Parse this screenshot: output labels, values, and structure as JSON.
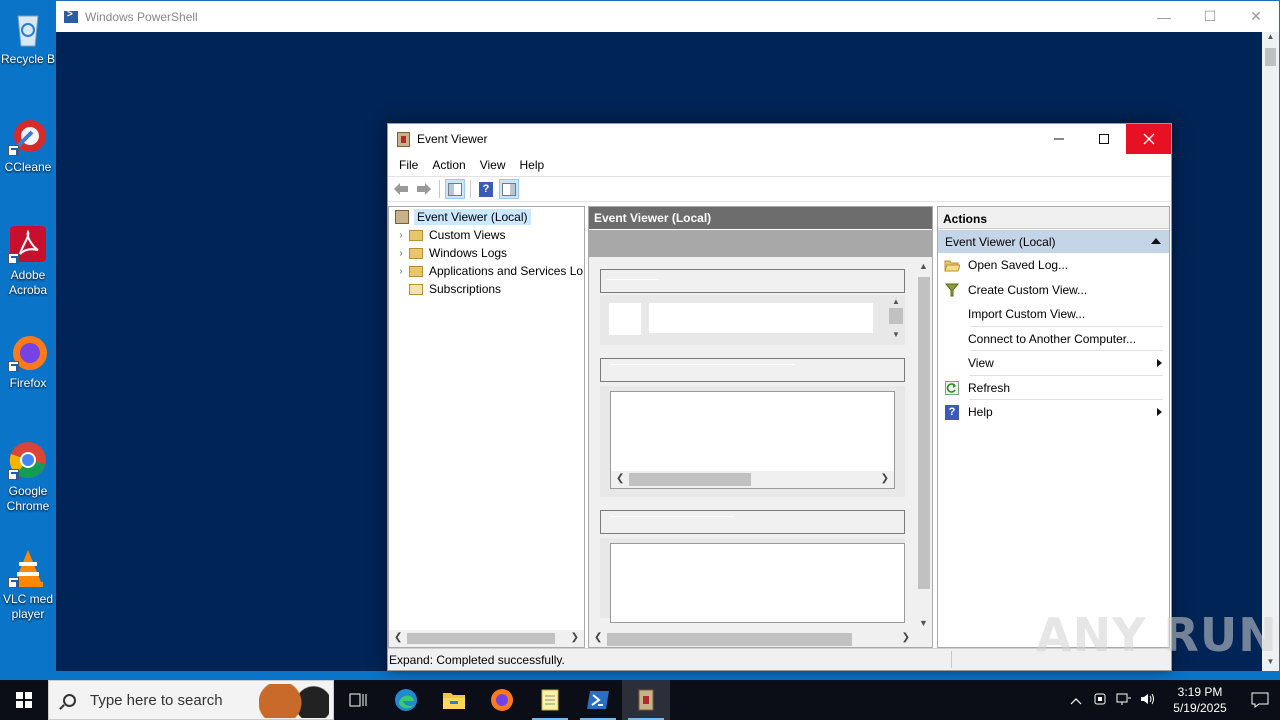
{
  "desktop": {
    "icons": [
      {
        "label": "Recycle B"
      },
      {
        "label": "CCleane"
      },
      {
        "label": "Adobe Acroba"
      },
      {
        "label": "Firefox"
      },
      {
        "label": "Google Chrome"
      },
      {
        "label": "VLC med player"
      }
    ]
  },
  "powershell": {
    "title": "Windows PowerShell",
    "controls": {
      "minimize": "—",
      "maximize": "☐",
      "close": "✕"
    }
  },
  "eventviewer": {
    "title": "Event Viewer",
    "menu": [
      "File",
      "Action",
      "View",
      "Help"
    ],
    "tree": {
      "root": "Event Viewer (Local)",
      "children": [
        "Custom Views",
        "Windows Logs",
        "Applications and Services Lo",
        "Subscriptions"
      ]
    },
    "center": {
      "header": "Event Viewer (Local)"
    },
    "actions": {
      "title": "Actions",
      "section": "Event Viewer (Local)",
      "items": [
        {
          "label": "Open Saved Log...",
          "icon": "folder-open-icon"
        },
        {
          "label": "Create Custom View...",
          "icon": "filter-icon"
        },
        {
          "label": "Import Custom View...",
          "icon": ""
        },
        {
          "label": "Connect to Another Computer...",
          "icon": ""
        },
        {
          "label": "View",
          "icon": "",
          "submenu": true
        },
        {
          "label": "Refresh",
          "icon": "refresh-icon"
        },
        {
          "label": "Help",
          "icon": "help-icon",
          "submenu": true
        }
      ]
    },
    "status": "Expand:  Completed successfully."
  },
  "taskbar": {
    "search_placeholder": "Type here to search",
    "clock_time": "3:19 PM",
    "clock_date": "5/19/2025"
  },
  "watermark": "ANY RUN",
  "colors": {
    "desktop": "#0a74c9",
    "powershell_bg": "#012456",
    "close_red": "#e81123",
    "actions_section": "#c5d5e8",
    "center_header": "#6d6d6d"
  }
}
